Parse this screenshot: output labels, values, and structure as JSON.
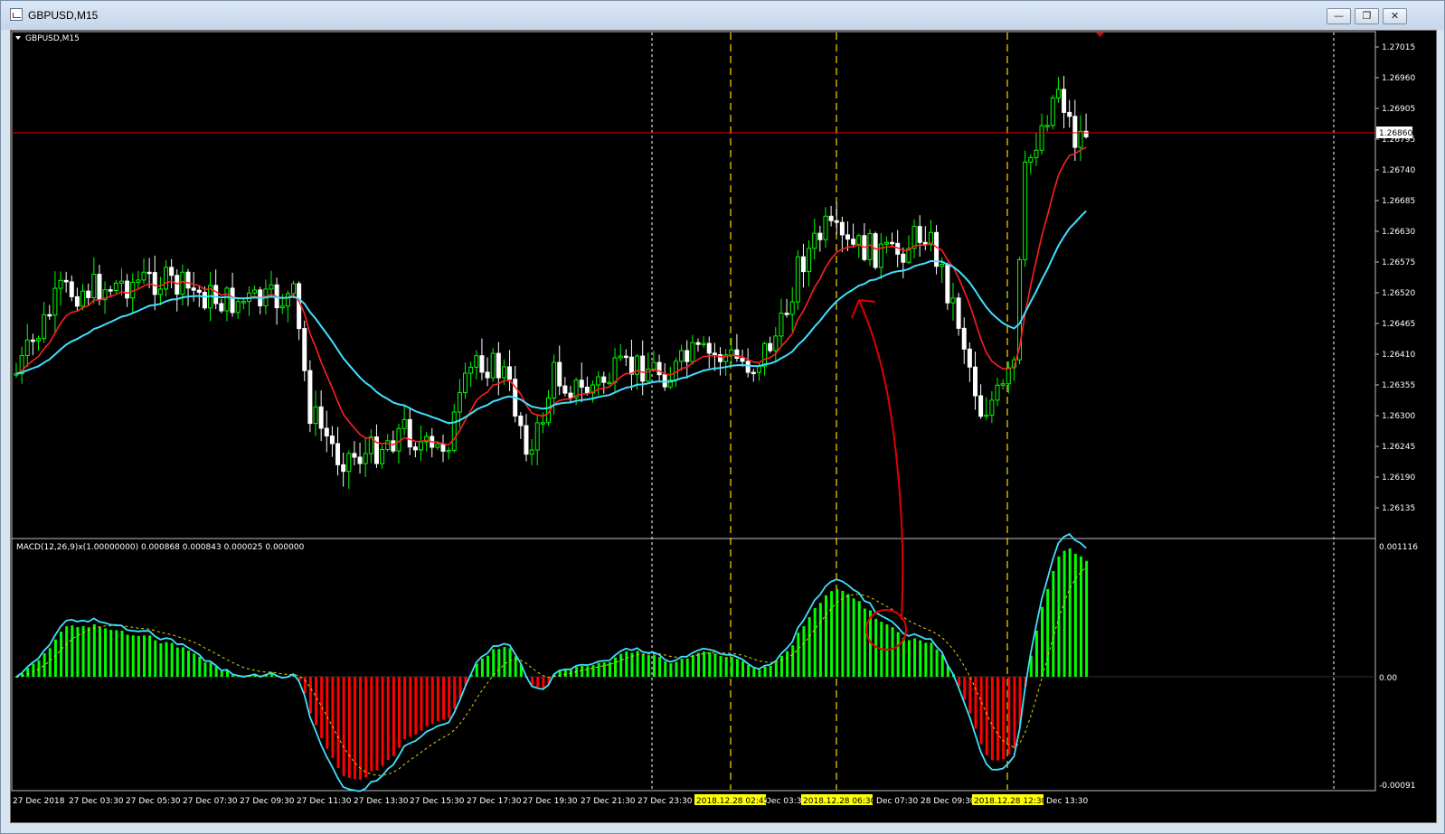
{
  "window": {
    "title": "GBPUSD,M15",
    "minimize_icon": "minimize-icon",
    "maximize_icon": "restore-icon",
    "close_icon": "close-icon"
  },
  "chart": {
    "symbol_label": "GBPUSD,M15",
    "price_ticks": [
      "1.27015",
      "1.26960",
      "1.26905",
      "1.26795",
      "1.26740",
      "1.26685",
      "1.26630",
      "1.26575",
      "1.26520",
      "1.26465",
      "1.26410",
      "1.26355",
      "1.26300",
      "1.26245",
      "1.26190",
      "1.26135"
    ],
    "current_price": "1.26860",
    "current_price_color": "#ff0000",
    "bull_color": "#00ff00",
    "bear_color": "#ffffff",
    "ma_fast_color": "#ff2020",
    "ma_slow_color": "#40e0ff",
    "vline_color": "#ffd700",
    "time_labels": [
      "27 Dec 2018",
      "27 Dec 03:30",
      "27 Dec 05:30",
      "27 Dec 07:30",
      "27 Dec 09:30",
      "27 Dec 11:30",
      "27 Dec 13:30",
      "27 Dec 15:30",
      "27 Dec 17:30",
      "27 Dec 19:30",
      "27 Dec 21:30",
      "27 Dec 23:30",
      "Dec 03:30",
      "Dec 07:30",
      "28 Dec 09:30",
      "Dec 13:30"
    ],
    "highlighted_time_labels": [
      "2018.12.28 02:45",
      "2018.12.28 06:30",
      "2018.12.28 12:30"
    ]
  },
  "macd": {
    "label": "MACD(12,26,9)x(1.00000000) 0.000868 0.000843 0.000025 0.000000",
    "ticks": [
      "0.001116",
      "0.00",
      "-0.00091"
    ]
  }
}
